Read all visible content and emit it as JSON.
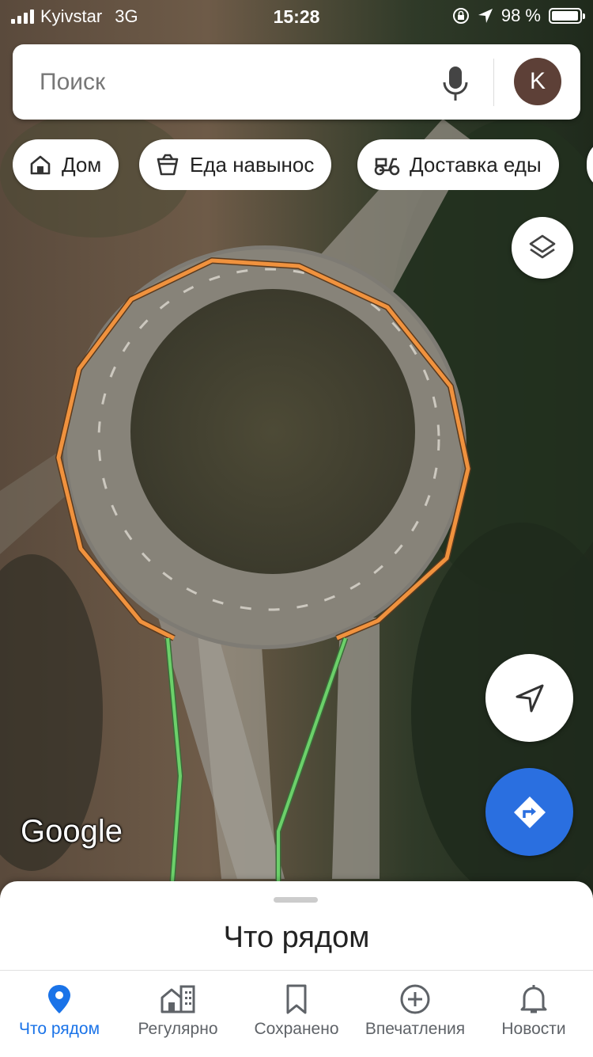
{
  "status_bar": {
    "carrier": "Kyivstar",
    "network": "3G",
    "time": "15:28",
    "battery_percent": "98 %",
    "battery_level": 0.98,
    "icons": [
      "signal-icon",
      "orientation-lock-icon",
      "location-arrow-icon",
      "battery-icon"
    ]
  },
  "search": {
    "placeholder": "Поиск",
    "mic_icon": "microphone-icon",
    "avatar_initial": "K",
    "avatar_color": "#5d4037"
  },
  "chips": [
    {
      "label": "Дом",
      "icon": "home-icon"
    },
    {
      "label": "Еда навынос",
      "icon": "takeout-icon"
    },
    {
      "label": "Доставка еды",
      "icon": "scooter-icon"
    }
  ],
  "map": {
    "layers_icon": "layers-icon",
    "locate_icon": "navigation-arrow-icon",
    "directions_icon": "directions-icon",
    "attribution": "Google",
    "route_colors": {
      "roundabout": "#f0923e",
      "approach": "#6cd06a"
    },
    "accent": "#2a6fe0"
  },
  "sheet": {
    "title": "Что рядом"
  },
  "bottom_nav": [
    {
      "label": "Что рядом",
      "icon": "pin-icon",
      "active": true
    },
    {
      "label": "Регулярно",
      "icon": "commute-icon",
      "active": false
    },
    {
      "label": "Сохранено",
      "icon": "bookmark-icon",
      "active": false
    },
    {
      "label": "Впечатления",
      "icon": "plus-circle-icon",
      "active": false
    },
    {
      "label": "Новости",
      "icon": "bell-icon",
      "active": false
    }
  ]
}
